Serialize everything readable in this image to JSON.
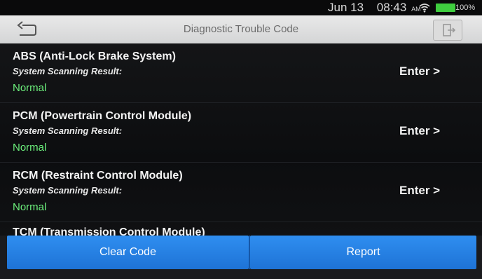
{
  "status_bar": {
    "date": "Jun 13",
    "time": "08:43",
    "ampm": "AM",
    "battery": "100%",
    "icons": [
      "wifi-icon",
      "battery-icon"
    ],
    "battery_color": "#3fce3f"
  },
  "header": {
    "title": "Diagnostic Trouble Code",
    "back_icon": "back-arrow-icon",
    "exit_icon": "exit-icon"
  },
  "list": {
    "items": [
      {
        "name": "ABS (Anti-Lock Brake System)",
        "label": "System Scanning Result:",
        "result": "Normal",
        "enter": "Enter >"
      },
      {
        "name": "PCM (Powertrain Control Module)",
        "label": "System Scanning Result:",
        "result": "Normal",
        "enter": "Enter >"
      },
      {
        "name": "RCM (Restraint Control Module)",
        "label": "System Scanning Result:",
        "result": "Normal",
        "enter": "Enter >"
      },
      {
        "name": "TCM (Transmission Control Module)"
      }
    ],
    "result_color": "#6cf07c"
  },
  "actions": {
    "clear_code": "Clear Code",
    "report": "Report",
    "accent": "#2f8ef0"
  }
}
